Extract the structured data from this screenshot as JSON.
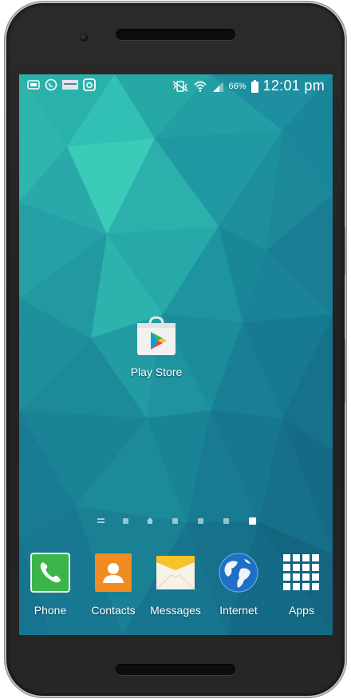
{
  "status_bar": {
    "battery_percent": "66%",
    "time": "12:01 pm",
    "left_icons": [
      "data-saver-icon",
      "whatsapp-icon",
      "gallery-thumbnail-icon",
      "instagram-icon"
    ],
    "right_icons": [
      "mute-vibrate-icon",
      "wifi-icon",
      "signal-icon",
      "battery-icon"
    ]
  },
  "home": {
    "apps": [
      {
        "label": "Play Store",
        "icon": "play-store-icon"
      }
    ],
    "page_indicator": {
      "pages": 7,
      "active_index": 6,
      "home_index": 2
    }
  },
  "dock": {
    "items": [
      {
        "label": "Phone",
        "icon": "phone-icon",
        "color": "#3bb54a"
      },
      {
        "label": "Contacts",
        "icon": "contacts-icon",
        "color": "#f08c22"
      },
      {
        "label": "Messages",
        "icon": "messages-icon",
        "color": "#f5c32c"
      },
      {
        "label": "Internet",
        "icon": "globe-icon",
        "color": "#1f6fc4"
      },
      {
        "label": "Apps",
        "icon": "apps-grid-icon",
        "color": "#ffffff"
      }
    ]
  },
  "colors": {
    "wallpaper_primary": "#1f9aa4",
    "wallpaper_dark": "#175f7e"
  }
}
